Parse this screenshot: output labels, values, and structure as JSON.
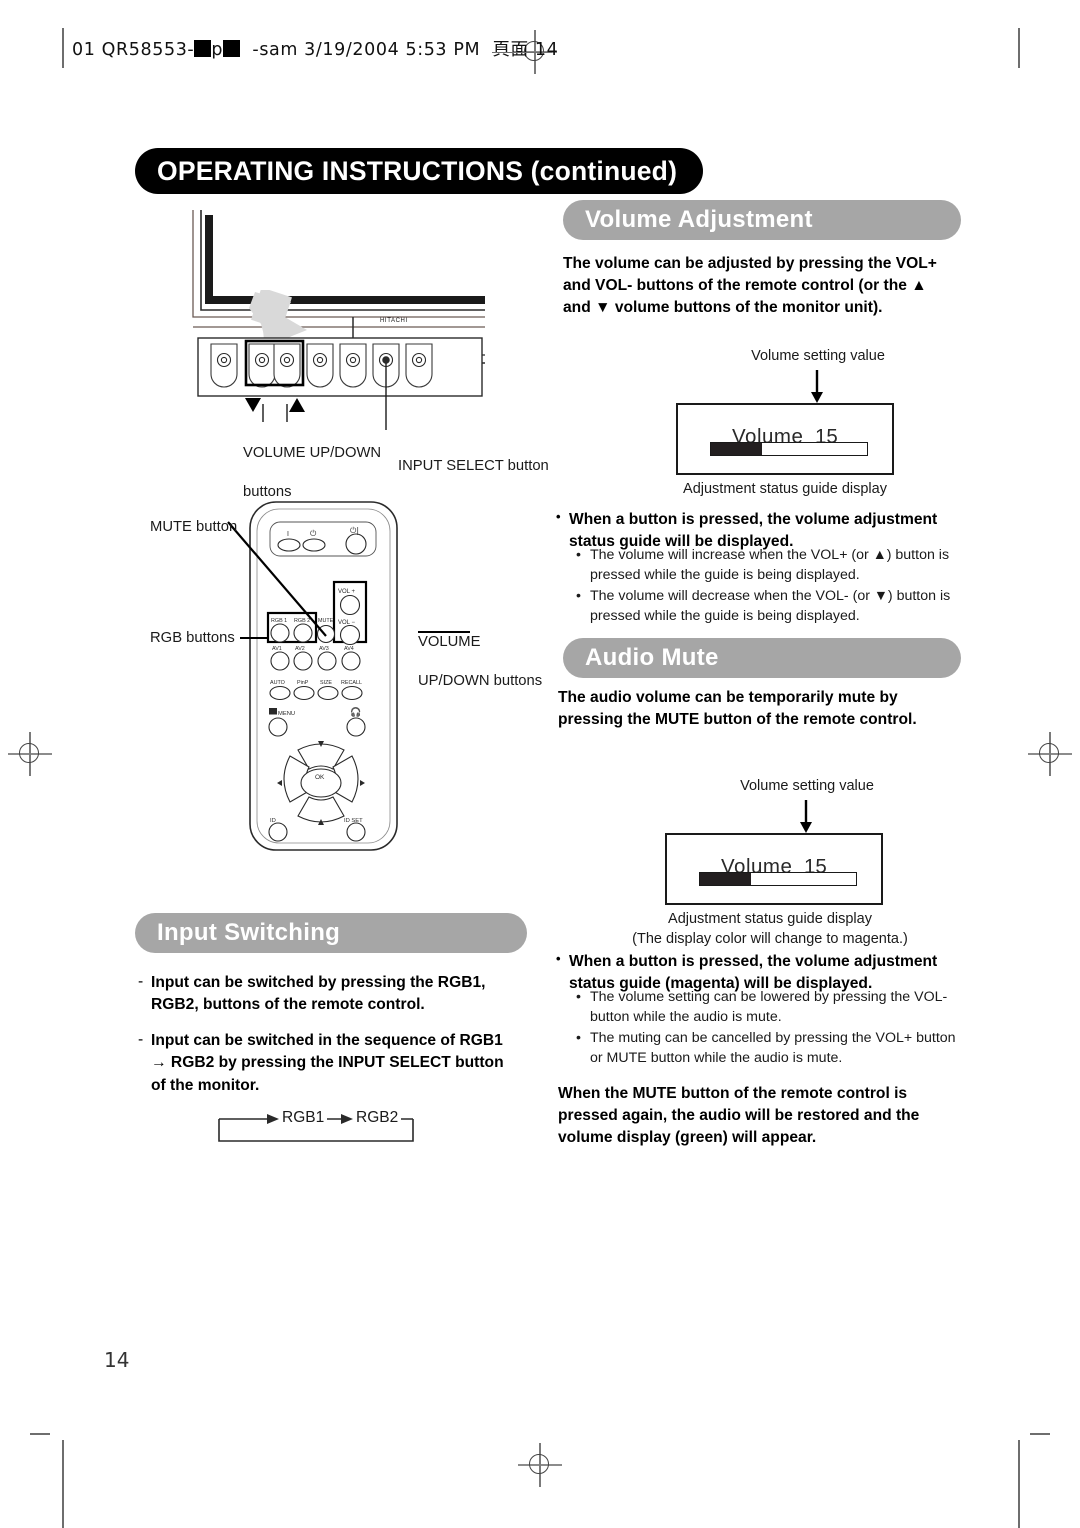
{
  "slug": {
    "text_before": "01 QR58553-",
    "mid": "p",
    "text_after": "-sam  3/19/2004  5:53 PM",
    "page_marker": "頁面 14"
  },
  "header": {
    "title": "OPERATING INSTRUCTIONS (continued)"
  },
  "folio": "14",
  "colors": {
    "header_pill": "#000000",
    "section_pill": "#a6a6a6",
    "osd_fill": "#231f20",
    "crop_mark": "#6e6e6e"
  },
  "monitor_figure": {
    "brand": "HITACHI",
    "down_triangle": "▼",
    "up_triangle": "▲",
    "label_volume": "VOLUME UP/DOWN",
    "label_volume_2": "buttons",
    "label_input_select": "INPUT SELECT button"
  },
  "remote_figure": {
    "label_mute": "MUTE button",
    "label_rgb": "RGB buttons",
    "label_volume_line1": "VOLUME",
    "label_volume_line2": "UP/DOWN buttons",
    "buttons": {
      "power_on": "I",
      "power_standby": "⏻",
      "power_toggle": "⏻|",
      "rgb1": "RGB 1",
      "rgb2": "RGB 2",
      "mute": "MUTE",
      "vol_up": "VOL +",
      "vol_down": "VOL −",
      "av1": "AV1",
      "av2": "AV2",
      "av3": "AV3",
      "av4": "AV4",
      "auto": "AUTO",
      "pinp": "PinP",
      "size": "SIZE",
      "recall": "RECALL",
      "menu": "MENU",
      "ok": "OK",
      "id": "ID",
      "id_set": "ID SET"
    }
  },
  "volume_adjustment": {
    "heading": "Volume Adjustment",
    "intro": "The volume can be adjusted by pressing the VOL+ and VOL- buttons of the remote control (or the ▲ and ▼ volume buttons of the monitor unit).",
    "osd": {
      "caption_top": "Volume setting value",
      "label": "Volume",
      "value": "15",
      "bar_percent": 33,
      "caption_bottom": "Adjustment status guide display"
    },
    "note_heading": "When a button is pressed, the volume adjustment status guide will be displayed.",
    "notes": [
      "The volume will increase when the VOL+ (or ▲) button is pressed while the guide is being displayed.",
      "The volume will decrease when the VOL- (or ▼) button is pressed while the guide is being displayed."
    ]
  },
  "audio_mute": {
    "heading": "Audio Mute",
    "intro": "The audio volume can be temporarily mute by pressing the MUTE button of the remote control.",
    "osd": {
      "caption_top": "Volume setting value",
      "label": "Volume",
      "value": "15",
      "bar_percent": 33,
      "caption_bottom_line1": "Adjustment status guide display",
      "caption_bottom_line2": "(The display color will change to magenta.)"
    },
    "note_heading": "When a button is pressed, the volume adjustment status guide (magenta) will be displayed.",
    "notes": [
      "The volume setting can be lowered by pressing the VOL- button while the audio is mute.",
      "The muting can be cancelled by pressing the VOL+ button or MUTE button while the audio is mute."
    ],
    "closing": "When the MUTE button of the remote control is pressed again, the audio will be restored and the volume display (green) will appear."
  },
  "input_switching": {
    "heading": "Input Switching",
    "items": [
      "Input can be switched by pressing the RGB1, RGB2, buttons of the remote control.",
      "Input can be switched in the sequence of RGB1 → RGB2 by pressing the INPUT SELECT button of the monitor."
    ],
    "flow": {
      "node1": "RGB1",
      "node2": "RGB2"
    }
  }
}
